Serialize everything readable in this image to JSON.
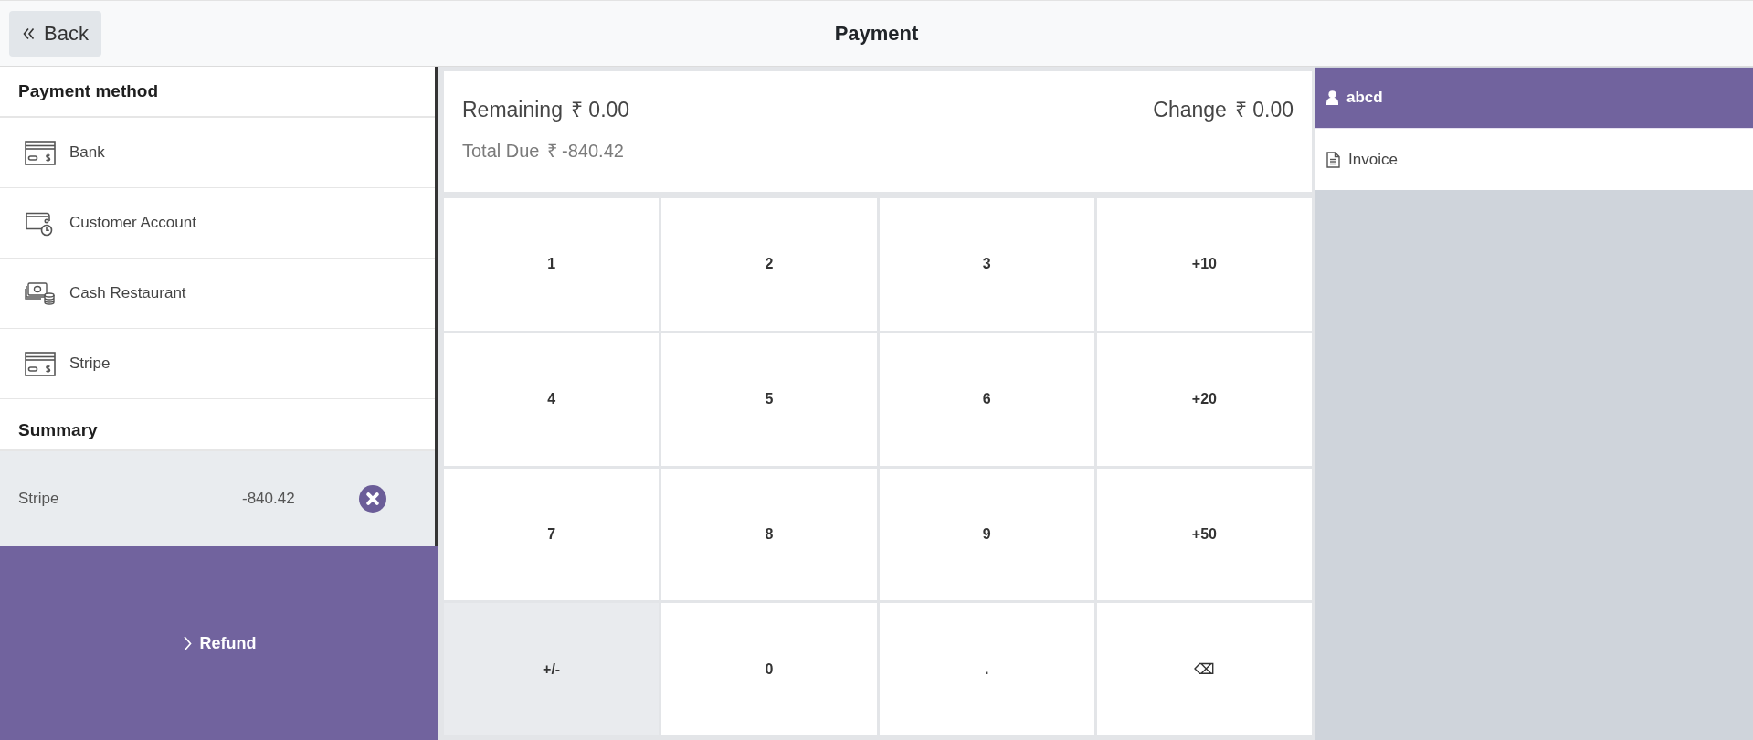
{
  "header": {
    "back_label": "Back",
    "title": "Payment"
  },
  "payment_methods": {
    "title": "Payment method",
    "items": [
      {
        "label": "Bank",
        "kind": "card"
      },
      {
        "label": "Customer Account",
        "kind": "account"
      },
      {
        "label": "Cash Restaurant",
        "kind": "cash"
      },
      {
        "label": "Stripe",
        "kind": "card"
      }
    ]
  },
  "summary": {
    "title": "Summary",
    "lines": [
      {
        "method": "Stripe",
        "amount": "-840.42"
      }
    ]
  },
  "refund_button": {
    "label": "Refund"
  },
  "totals": {
    "remaining_label": "Remaining",
    "remaining": "₹ 0.00",
    "change_label": "Change",
    "change": "₹ 0.00",
    "total_due_label": "Total Due",
    "total_due": "₹ -840.42"
  },
  "keypad": [
    {
      "label": "1",
      "kind": "digit"
    },
    {
      "label": "2",
      "kind": "digit"
    },
    {
      "label": "3",
      "kind": "digit"
    },
    {
      "label": "+10",
      "kind": "quick-add"
    },
    {
      "label": "4",
      "kind": "digit"
    },
    {
      "label": "5",
      "kind": "digit"
    },
    {
      "label": "6",
      "kind": "digit"
    },
    {
      "label": "+20",
      "kind": "quick-add"
    },
    {
      "label": "7",
      "kind": "digit"
    },
    {
      "label": "8",
      "kind": "digit"
    },
    {
      "label": "9",
      "kind": "digit"
    },
    {
      "label": "+50",
      "kind": "quick-add"
    },
    {
      "label": "+/-",
      "kind": "sign"
    },
    {
      "label": "0",
      "kind": "digit"
    },
    {
      "label": ".",
      "kind": "decimal"
    },
    {
      "label": "⌫",
      "kind": "backspace"
    }
  ],
  "customer_button": {
    "label": "abcd"
  },
  "invoice_button": {
    "label": "Invoice",
    "selected": false
  }
}
